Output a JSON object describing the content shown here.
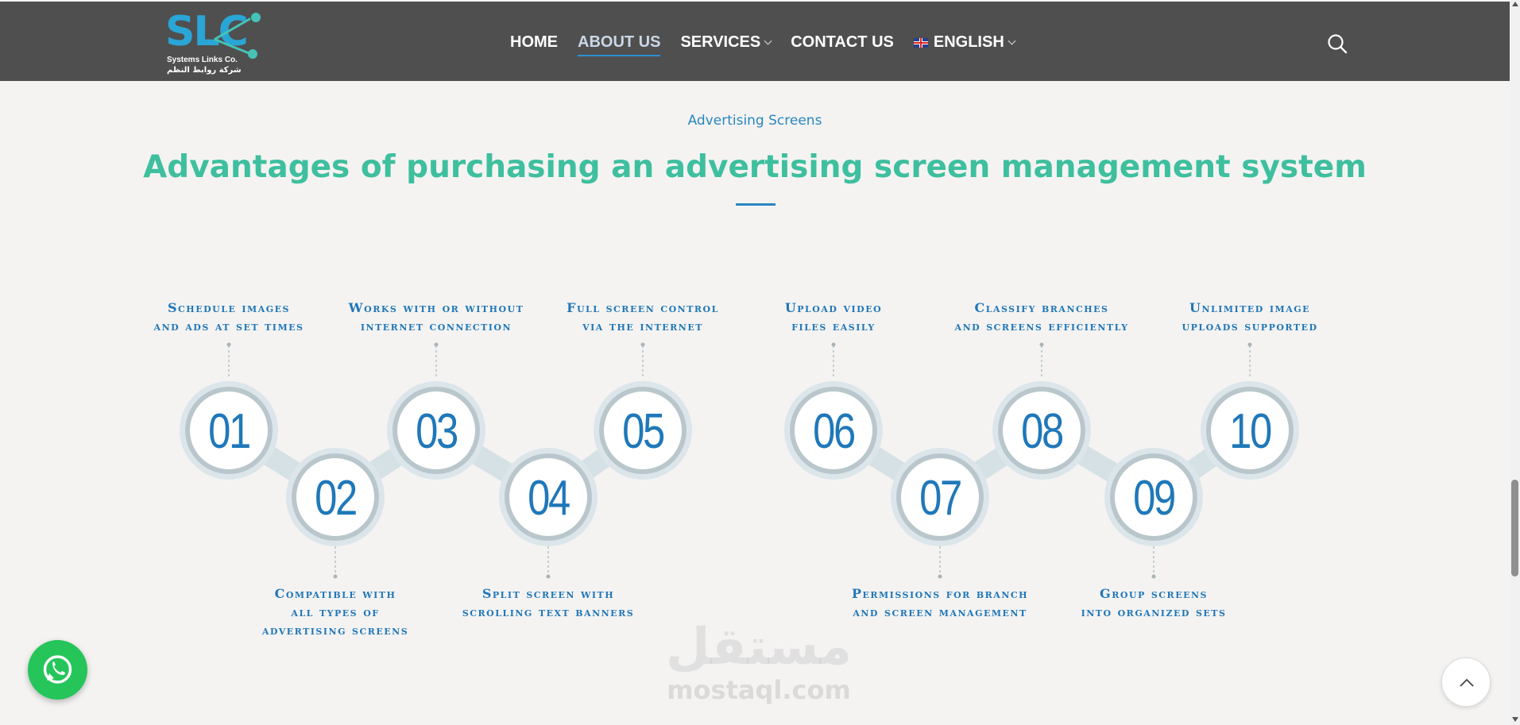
{
  "header": {
    "logo": {
      "mark": "SLC",
      "company_en": "Systems Links Co.",
      "company_ar": "شركة روابط النظم"
    },
    "nav": [
      {
        "label": "HOME",
        "active": false,
        "has_dropdown": false
      },
      {
        "label": "ABOUT US",
        "active": true,
        "has_dropdown": false
      },
      {
        "label": "SERVICES",
        "active": false,
        "has_dropdown": true
      },
      {
        "label": "CONTACT US",
        "active": false,
        "has_dropdown": false
      },
      {
        "label": "ENGLISH",
        "active": false,
        "has_dropdown": true,
        "icon": "uk-flag-icon"
      }
    ],
    "search_icon": "search-icon"
  },
  "section": {
    "eyebrow": "Advertising Screens",
    "title": "Advantages of purchasing an advertising screen management system"
  },
  "steps": [
    {
      "number": "01",
      "label_lines": [
        "Schedule images",
        "and ads at set times"
      ],
      "position": "top"
    },
    {
      "number": "02",
      "label_lines": [
        "Compatible with",
        "all types of",
        "advertising screens"
      ],
      "position": "bottom"
    },
    {
      "number": "03",
      "label_lines": [
        "Works with or without",
        "internet connection"
      ],
      "position": "top"
    },
    {
      "number": "04",
      "label_lines": [
        "Split screen with",
        "scrolling text banners"
      ],
      "position": "bottom"
    },
    {
      "number": "05",
      "label_lines": [
        "Full screen control",
        "via the internet"
      ],
      "position": "top"
    },
    {
      "number": "06",
      "label_lines": [
        "Upload video",
        "files easily"
      ],
      "position": "top"
    },
    {
      "number": "07",
      "label_lines": [
        "Permissions for branch",
        "and screen management"
      ],
      "position": "bottom"
    },
    {
      "number": "08",
      "label_lines": [
        "Classify branches",
        "and screens efficiently"
      ],
      "position": "top"
    },
    {
      "number": "09",
      "label_lines": [
        "Group screens",
        "into organized sets"
      ],
      "position": "bottom"
    },
    {
      "number": "10",
      "label_lines": [
        "Unlimited image",
        "uploads supported"
      ],
      "position": "top"
    }
  ],
  "floating": {
    "whatsapp_icon": "whatsapp-icon",
    "back_to_top_icon": "chevron-up-icon"
  },
  "watermark": {
    "arabic": "مستقل",
    "latin": "mostaql.com"
  },
  "colors": {
    "header_bg": "#4f4f4f",
    "accent_blue": "#2a86c0",
    "title_green": "#3ebf9e",
    "number_blue": "#1f78b9",
    "whatsapp_green": "#25c55a"
  }
}
